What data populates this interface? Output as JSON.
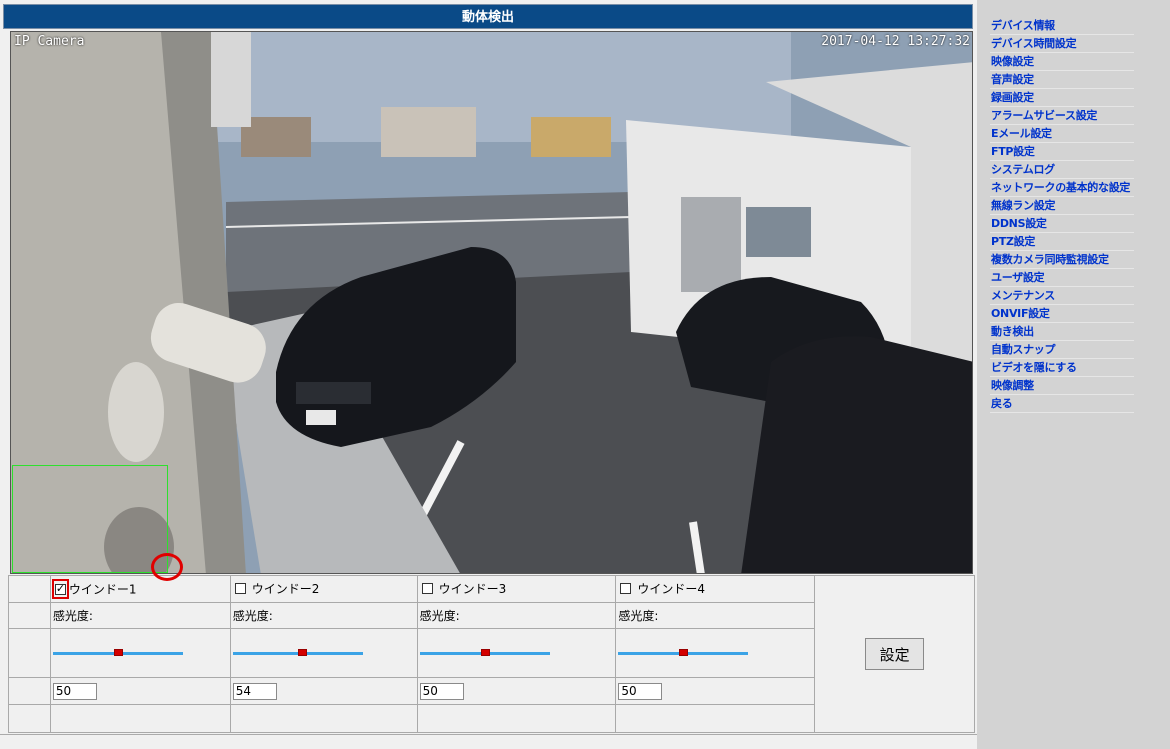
{
  "page": {
    "title": "動体検出"
  },
  "camera": {
    "name_overlay": "IP Camera",
    "timestamp_overlay": "2017-04-12 13:27:32"
  },
  "windows": [
    {
      "label": "ウインドー1",
      "checked": true,
      "sensitivity_label": "感光度:",
      "value": "50",
      "slider_fraction": 0.5
    },
    {
      "label": "ウインドー2",
      "checked": false,
      "sensitivity_label": "感光度:",
      "value": "54",
      "slider_fraction": 0.54
    },
    {
      "label": "ウインドー3",
      "checked": false,
      "sensitivity_label": "感光度:",
      "value": "50",
      "slider_fraction": 0.5
    },
    {
      "label": "ウインドー4",
      "checked": false,
      "sensitivity_label": "感光度:",
      "value": "50",
      "slider_fraction": 0.5
    }
  ],
  "buttons": {
    "set_label": "設定"
  },
  "sidebar": {
    "items": [
      {
        "label": "デバイス情報"
      },
      {
        "label": "デバイス時間設定"
      },
      {
        "label": "映像設定"
      },
      {
        "label": "音声設定"
      },
      {
        "label": "録画設定"
      },
      {
        "label": "アラームサビース設定"
      },
      {
        "label": "Eメール設定"
      },
      {
        "label": "FTP設定"
      },
      {
        "label": "システムログ"
      },
      {
        "label": "ネットワークの基本的な設定"
      },
      {
        "label": "無線ラン設定"
      },
      {
        "label": "DDNS設定"
      },
      {
        "label": "PTZ設定"
      },
      {
        "label": "複数カメラ同時監視設定"
      },
      {
        "label": "ユーザ設定"
      },
      {
        "label": "メンテナンス"
      },
      {
        "label": "ONVIF設定"
      },
      {
        "label": "動き検出"
      },
      {
        "label": "自動スナップ"
      },
      {
        "label": "ビデオを隠にする"
      },
      {
        "label": "映像調整"
      },
      {
        "label": "戻る"
      }
    ]
  },
  "colors": {
    "title_bar": "#0a4a87",
    "link": "#0033cc",
    "slider_track": "#3ba3e6",
    "slider_thumb": "#d40000",
    "roi_border": "#2ee02e",
    "highlight": "#e00000"
  }
}
